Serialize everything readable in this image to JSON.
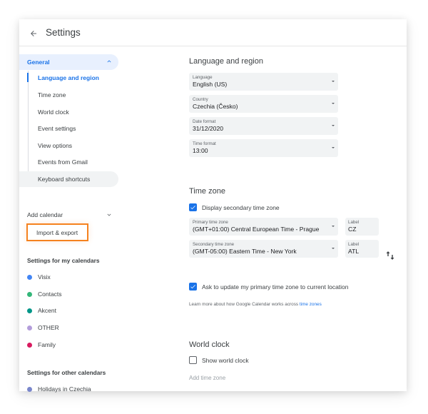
{
  "header": {
    "title": "Settings",
    "back_icon": "arrow-left-icon"
  },
  "sidebar": {
    "general": {
      "label": "General",
      "expanded": true
    },
    "general_items": [
      {
        "label": "Language and region",
        "active": true
      },
      {
        "label": "Time zone"
      },
      {
        "label": "World clock"
      },
      {
        "label": "Event settings"
      },
      {
        "label": "View options"
      },
      {
        "label": "Events from Gmail"
      },
      {
        "label": "Keyboard shortcuts",
        "hovered": true
      }
    ],
    "add_calendar": {
      "label": "Add calendar",
      "expanded": false
    },
    "import_export": {
      "label": "Import & export",
      "highlight_color": "#f5821f"
    },
    "my_calendars_heading": "Settings for my calendars",
    "my_calendars": [
      {
        "label": "Visix",
        "color": "#4285f4"
      },
      {
        "label": "Contacts",
        "color": "#33b679"
      },
      {
        "label": "Akcent",
        "color": "#009688"
      },
      {
        "label": "OTHER",
        "color": "#b39ddb"
      },
      {
        "label": "Family",
        "color": "#d81b60"
      }
    ],
    "other_calendars_heading": "Settings for other calendars",
    "other_calendars": [
      {
        "label": "Holidays in Czechia",
        "color": "#7986cb"
      }
    ]
  },
  "main": {
    "language_region": {
      "heading": "Language and region",
      "fields": [
        {
          "label": "Language",
          "value": "English (US)"
        },
        {
          "label": "Country",
          "value": "Czechia (Česko)"
        },
        {
          "label": "Date format",
          "value": "31/12/2020"
        },
        {
          "label": "Time format",
          "value": "13:00"
        }
      ]
    },
    "time_zone": {
      "heading": "Time zone",
      "display_secondary": {
        "label": "Display secondary time zone",
        "checked": true
      },
      "primary": {
        "label": "Primary time zone",
        "value": "(GMT+01:00) Central European Time - Prague",
        "tag_label": "Label",
        "tag_value": "CZ"
      },
      "secondary": {
        "label": "Secondary time zone",
        "value": "(GMT-05:00) Eastern Time - New York",
        "tag_label": "Label",
        "tag_value": "ATL"
      },
      "swap_icon": "swap-vertical-icon",
      "ask_update": {
        "label": "Ask to update my primary time zone to current location",
        "checked": true
      },
      "learn_more_text": "Learn more about how Google Calendar works across ",
      "learn_more_link": "time zones"
    },
    "world_clock": {
      "heading": "World clock",
      "show": {
        "label": "Show world clock",
        "checked": false
      },
      "add_time_zone": "Add time zone"
    }
  },
  "colors": {
    "accent": "#1a73e8",
    "active_bg": "#e8f0fe",
    "field_bg": "#f1f3f4",
    "highlight": "#f5821f"
  }
}
